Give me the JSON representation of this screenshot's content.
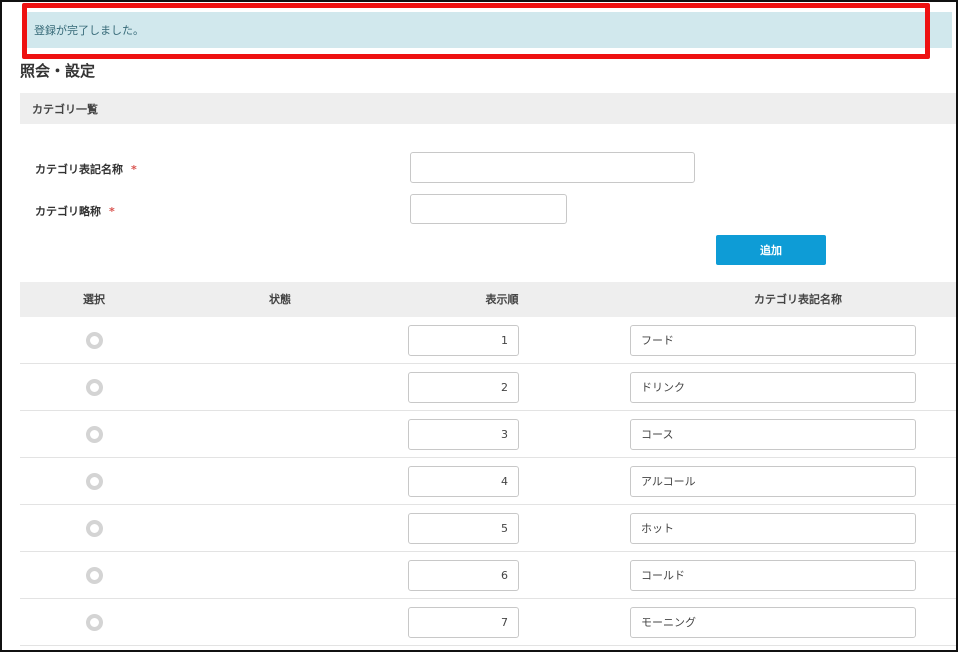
{
  "alert": {
    "message": "登録が完了しました。"
  },
  "page": {
    "title": "照会・設定"
  },
  "section": {
    "title": "カテゴリ一覧"
  },
  "form": {
    "category_name_label": "カテゴリ表記名称",
    "category_abbr_label": "カテゴリ略称",
    "required_mark": "*",
    "category_name_value": "",
    "category_abbr_value": "",
    "add_button_label": "追加"
  },
  "table": {
    "columns": {
      "select": "選択",
      "status": "状態",
      "order": "表示順",
      "name": "カテゴリ表記名称"
    },
    "rows": [
      {
        "order": "1",
        "name": "フード",
        "status": ""
      },
      {
        "order": "2",
        "name": "ドリンク",
        "status": ""
      },
      {
        "order": "3",
        "name": "コース",
        "status": ""
      },
      {
        "order": "4",
        "name": "アルコール",
        "status": ""
      },
      {
        "order": "5",
        "name": "ホット",
        "status": ""
      },
      {
        "order": "6",
        "name": "コールド",
        "status": ""
      },
      {
        "order": "7",
        "name": "モーニング",
        "status": ""
      }
    ]
  },
  "colors": {
    "alert_bg": "#d1e8ed",
    "highlight_border": "#ee1111",
    "accent_button": "#0e9cd6",
    "required": "#d9534f"
  }
}
